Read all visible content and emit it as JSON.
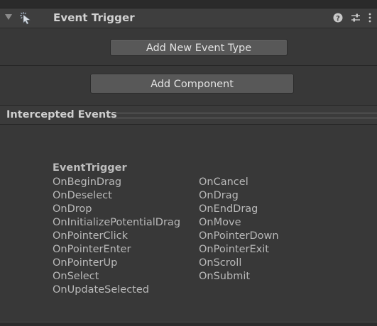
{
  "component": {
    "title": "Event Trigger",
    "icon": "event-trigger-icon"
  },
  "buttons": {
    "add_event_type": "Add New Event Type",
    "add_component": "Add Component"
  },
  "section": {
    "title": "Intercepted Events"
  },
  "events": {
    "title": "EventTrigger",
    "left": [
      "OnBeginDrag",
      "OnDeselect",
      "OnDrop",
      "OnInitializePotentialDrag",
      "OnPointerClick",
      "OnPointerEnter",
      "OnPointerUp",
      "OnSelect",
      "OnUpdateSelected"
    ],
    "right": [
      "OnCancel",
      "OnDrag",
      "OnEndDrag",
      "OnMove",
      "OnPointerDown",
      "OnPointerExit",
      "OnScroll",
      "OnSubmit"
    ]
  },
  "colors": {
    "background": "#383838",
    "header": "#3e3e3e",
    "button": "#585858",
    "text": "#c4c4c4"
  }
}
